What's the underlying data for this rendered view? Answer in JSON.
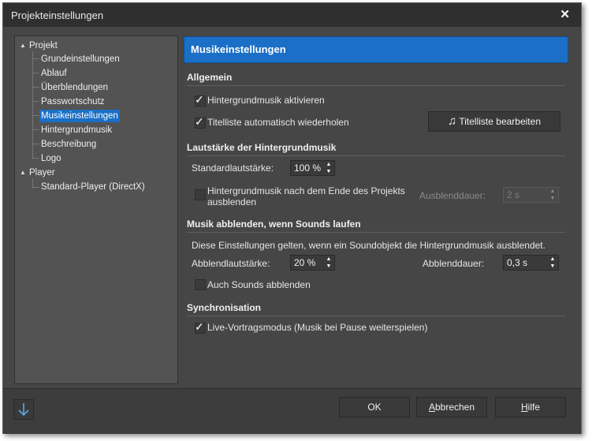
{
  "window": {
    "title": "Projekteinstellungen",
    "close_glyph": "✕"
  },
  "tree": {
    "nodes": [
      {
        "label": "Projekt",
        "expander": "▲"
      },
      {
        "label": "Grundeinstellungen"
      },
      {
        "label": "Ablauf"
      },
      {
        "label": "Überblendungen"
      },
      {
        "label": "Passwortschutz"
      },
      {
        "label": "Musikeinstellungen",
        "selected": true
      },
      {
        "label": "Hintergrundmusik"
      },
      {
        "label": "Beschreibung"
      },
      {
        "label": "Logo"
      },
      {
        "label": "Player",
        "expander": "▲"
      },
      {
        "label": "Standard-Player (DirectX)"
      }
    ]
  },
  "panel": {
    "header": "Musikeinstellungen",
    "allgemein": {
      "title": "Allgemein",
      "cb_music": {
        "label": "Hintergrundmusik aktivieren",
        "checked": true
      },
      "cb_repeat": {
        "label": "Titelliste automatisch wiederholen",
        "checked": true
      },
      "btn_titlelist": {
        "label": "Titelliste bearbeiten",
        "icon": "music-note-icon"
      }
    },
    "volume": {
      "title": "Lautstärke der Hintergrundmusik",
      "standard_label": "Standardlautstärke:",
      "standard_value": "100 %",
      "cb_fade_line1": "Hintergrundmusik nach dem Ende des Projekts",
      "cb_fade_line2": "ausblenden",
      "fadeout_label": "Ausblenddauer:",
      "fadeout_value": "2 s"
    },
    "duck": {
      "title": "Musik abblenden, wenn Sounds laufen",
      "description": "Diese Einstellungen gelten, wenn ein Soundobjekt die Hintergrundmusik ausblendet.",
      "volume_label": "Abblendlautstärke:",
      "volume_value": "20 %",
      "duration_label": "Abblenddauer:",
      "duration_value": "0,3 s",
      "cb_sounds": {
        "label": "Auch Sounds abblenden",
        "checked": false
      }
    },
    "sync": {
      "title": "Synchronisation",
      "cb_live": {
        "label": "Live-Vortragsmodus (Musik bei Pause weiterspielen)",
        "checked": true
      }
    }
  },
  "footer": {
    "ok": "OK",
    "cancel_u": "A",
    "cancel_rest": "bbrechen",
    "help_u": "H",
    "help_rest": "ilfe"
  },
  "colors": {
    "accent": "#1b6fc6",
    "window_bg": "#464646",
    "panel_bg": "#535353"
  }
}
